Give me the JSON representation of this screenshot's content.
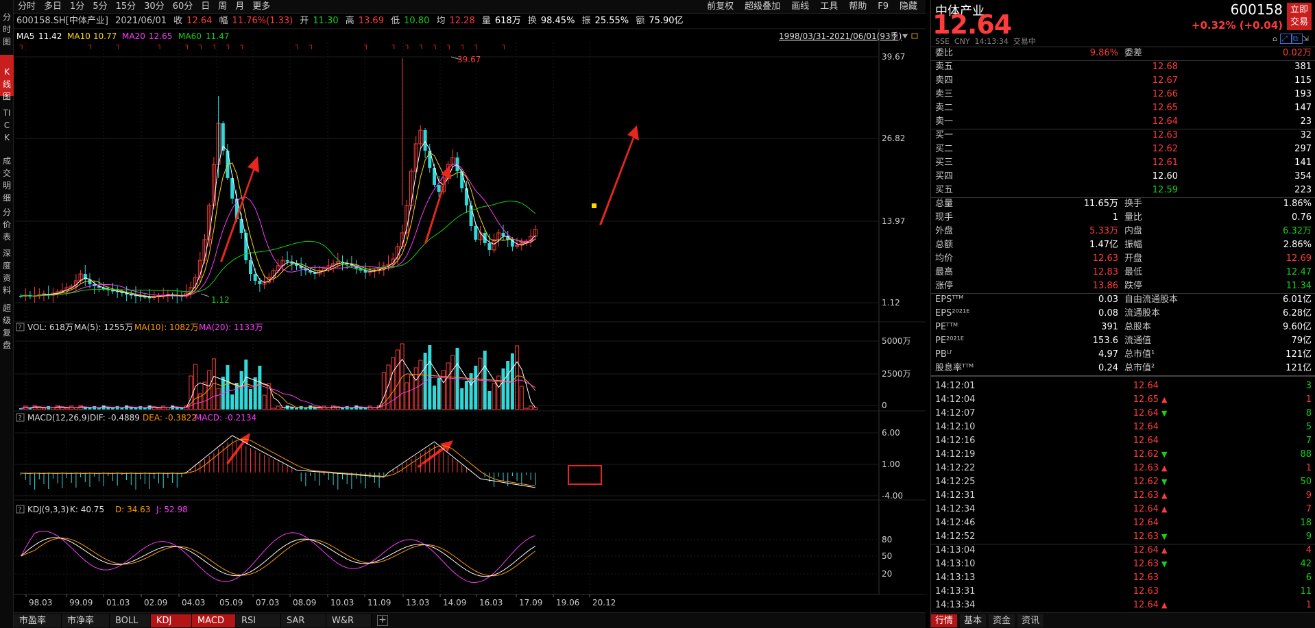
{
  "left_nav": [
    {
      "label": "分时图"
    },
    {
      "label": "K线图"
    },
    {
      "label": "TICK"
    },
    {
      "label": "成交明细"
    },
    {
      "label": "分价表"
    },
    {
      "label": "深度资料"
    },
    {
      "label": "超级复盘"
    }
  ],
  "period_tabs": [
    "分时",
    "多日",
    "1分",
    "5分",
    "15分",
    "30分",
    "60分",
    "日",
    "周",
    "月",
    "更多"
  ],
  "menu_right": [
    "前复权",
    "超级叠加",
    "画线",
    "工具",
    "帮助",
    "F9",
    "隐藏"
  ],
  "stock": {
    "code_name": "600158.SH[中体产业]",
    "date": "2021/06/01",
    "close_label": "收",
    "close": "12.64",
    "amp_label": "幅",
    "amp": "11.76%(1.33)",
    "open_label": "开",
    "open": "11.30",
    "high_label": "高",
    "high": "13.69",
    "low_label": "低",
    "low": "10.80",
    "avg_label": "均",
    "avg": "12.28",
    "vol_label": "量",
    "vol": "618万",
    "turn_label": "换",
    "turn": "98.45%",
    "swing_label": "振",
    "swing": "25.55%",
    "amt_label": "额",
    "amt": "75.90亿"
  },
  "ma_legend": {
    "ma5": "MA5",
    "ma5v": "11.42",
    "ma10": "MA10",
    "ma10v": "10.77",
    "ma20": "MA20",
    "ma20v": "12.65",
    "ma60": "MA60",
    "ma60v": "11.47"
  },
  "range_label": "1998/03/31-2021/06/01(93季)",
  "vol_legend": {
    "vol": "VOL: 618万",
    "ma5": "MA(5): 1255万",
    "ma10": "MA(10): 1082万",
    "ma20": "MA(20): 1133万"
  },
  "macd_legend": {
    "name": "MACD(12,26,9)",
    "dif": "DIF: -0.4889",
    "dea": "DEA: -0.3822",
    "macd": "MACD: -0.2134"
  },
  "kdj_legend": {
    "name": "KDJ(9,3,3)",
    "k": "K: 40.75",
    "d": "D: 34.63",
    "j": "J: 52.98"
  },
  "chart_data": [
    {
      "type": "candlestick",
      "title": "600158.SH[中体产业] 季线",
      "x_labels": [
        "98.03",
        "99.09",
        "01.03",
        "02.09",
        "04.03",
        "05.09",
        "07.03",
        "08.09",
        "10.03",
        "11.09",
        "13.03",
        "14.09",
        "16.03",
        "17.09",
        "19.06",
        "20.12"
      ],
      "y_ticks": [
        "39.67",
        "26.82",
        "13.97",
        "1.12"
      ],
      "y_scale": "log",
      "annotations": [
        "39.67",
        "1.12"
      ],
      "series": [
        {
          "name": "MA5",
          "color": "#ffffff"
        },
        {
          "name": "MA10",
          "color": "#ffd800"
        },
        {
          "name": "MA20",
          "color": "#ff3aff"
        },
        {
          "name": "MA60",
          "color": "#14d214"
        }
      ]
    },
    {
      "type": "bar",
      "title": "VOL",
      "y_ticks": [
        "5000万",
        "2500万",
        "0"
      ]
    },
    {
      "type": "line",
      "title": "MACD(12,26,9)",
      "y_ticks": [
        "6.00",
        "1.00",
        "-4.00"
      ]
    },
    {
      "type": "line",
      "title": "KDJ(9,3,3)",
      "y_ticks": [
        "80",
        "50",
        "20"
      ]
    }
  ],
  "footer_tabs": [
    "市盈率",
    "市净率",
    "BOLL",
    "KDJ",
    "MACD",
    "RSI",
    "SAR",
    "W&R"
  ],
  "right": {
    "name": "中体产业",
    "code": "600158",
    "price": "12.64",
    "change": "+0.32% (+0.04)",
    "trade_btn": "立即交易",
    "exch": "SSE  CNY  14:13:34  交易中",
    "weibi_label": "委比",
    "weibi": "9.86%",
    "weicha_label": "委差",
    "weicha": "0.02万",
    "asks": [
      {
        "l": "卖五",
        "p": "12.68",
        "v": "381"
      },
      {
        "l": "卖四",
        "p": "12.67",
        "v": "115"
      },
      {
        "l": "卖三",
        "p": "12.66",
        "v": "193"
      },
      {
        "l": "卖二",
        "p": "12.65",
        "v": "147"
      },
      {
        "l": "卖一",
        "p": "12.64",
        "v": "23"
      }
    ],
    "bids": [
      {
        "l": "买一",
        "p": "12.63",
        "v": "32"
      },
      {
        "l": "买二",
        "p": "12.62",
        "v": "297"
      },
      {
        "l": "买三",
        "p": "12.61",
        "v": "141"
      },
      {
        "l": "买四",
        "p": "12.60",
        "v": "354"
      },
      {
        "l": "买五",
        "p": "12.59",
        "v": "223"
      }
    ],
    "stats": [
      {
        "a": "总量",
        "av": "11.65万",
        "b": "换手",
        "bv": "1.86%"
      },
      {
        "a": "现手",
        "av": "1",
        "b": "量比",
        "bv": "0.76"
      },
      {
        "a": "外盘",
        "av": "5.33万",
        "b": "内盘",
        "bv": "6.32万"
      },
      {
        "a": "总额",
        "av": "1.47亿",
        "b": "振幅",
        "bv": "2.86%"
      },
      {
        "a": "均价",
        "av": "12.63",
        "b": "开盘",
        "bv": "12.69"
      },
      {
        "a": "最高",
        "av": "12.83",
        "b": "最低",
        "bv": "12.47"
      },
      {
        "a": "涨停",
        "av": "13.86",
        "b": "跌停",
        "bv": "11.34"
      }
    ],
    "fund": [
      {
        "a": "EPSᵀᵀᴹ",
        "av": "0.03",
        "b": "自由流通股本",
        "bv": "6.01亿"
      },
      {
        "a": "EPS²⁰²¹ᴱ",
        "av": "0.08",
        "b": "流通股本",
        "bv": "6.28亿"
      },
      {
        "a": "PEᵀᵀᴹ",
        "av": "391",
        "b": "总股本",
        "bv": "9.60亿"
      },
      {
        "a": "PE²⁰²¹ᴱ",
        "av": "153.6",
        "b": "流通值",
        "bv": "79亿"
      },
      {
        "a": "PBᴸᶠ",
        "av": "4.97",
        "b": "总市值¹",
        "bv": "121亿"
      },
      {
        "a": "股息率ᵀᵀᴹ",
        "av": "0.24",
        "b": "总市值²",
        "bv": "121亿"
      }
    ],
    "ticks": [
      {
        "t": "14:12:01",
        "p": "12.64",
        "d": "",
        "v": "3"
      },
      {
        "t": "14:12:04",
        "p": "12.65",
        "d": "up",
        "v": "1"
      },
      {
        "t": "14:12:07",
        "p": "12.64",
        "d": "dn",
        "v": "8"
      },
      {
        "t": "14:12:10",
        "p": "12.64",
        "d": "",
        "v": "5"
      },
      {
        "t": "14:12:16",
        "p": "12.64",
        "d": "",
        "v": "7"
      },
      {
        "t": "14:12:19",
        "p": "12.62",
        "d": "dn",
        "v": "88"
      },
      {
        "t": "14:12:22",
        "p": "12.63",
        "d": "up",
        "v": "1"
      },
      {
        "t": "14:12:25",
        "p": "12.62",
        "d": "dn",
        "v": "50"
      },
      {
        "t": "14:12:31",
        "p": "12.63",
        "d": "up",
        "v": "9"
      },
      {
        "t": "14:12:34",
        "p": "12.64",
        "d": "up",
        "v": "7"
      },
      {
        "t": "14:12:46",
        "p": "12.64",
        "d": "",
        "v": "18"
      },
      {
        "t": "14:12:52",
        "p": "12.63",
        "d": "dn",
        "v": "9"
      },
      {
        "t": "14:13:04",
        "p": "12.64",
        "d": "up",
        "v": "4"
      },
      {
        "t": "14:13:10",
        "p": "12.63",
        "d": "dn",
        "v": "42"
      },
      {
        "t": "14:13:13",
        "p": "12.63",
        "d": "",
        "v": "6"
      },
      {
        "t": "14:13:31",
        "p": "12.63",
        "d": "",
        "v": "11"
      },
      {
        "t": "14:13:34",
        "p": "12.64",
        "d": "up",
        "v": "1"
      }
    ],
    "tabs": [
      "行情",
      "基本",
      "资金",
      "资讯"
    ]
  }
}
